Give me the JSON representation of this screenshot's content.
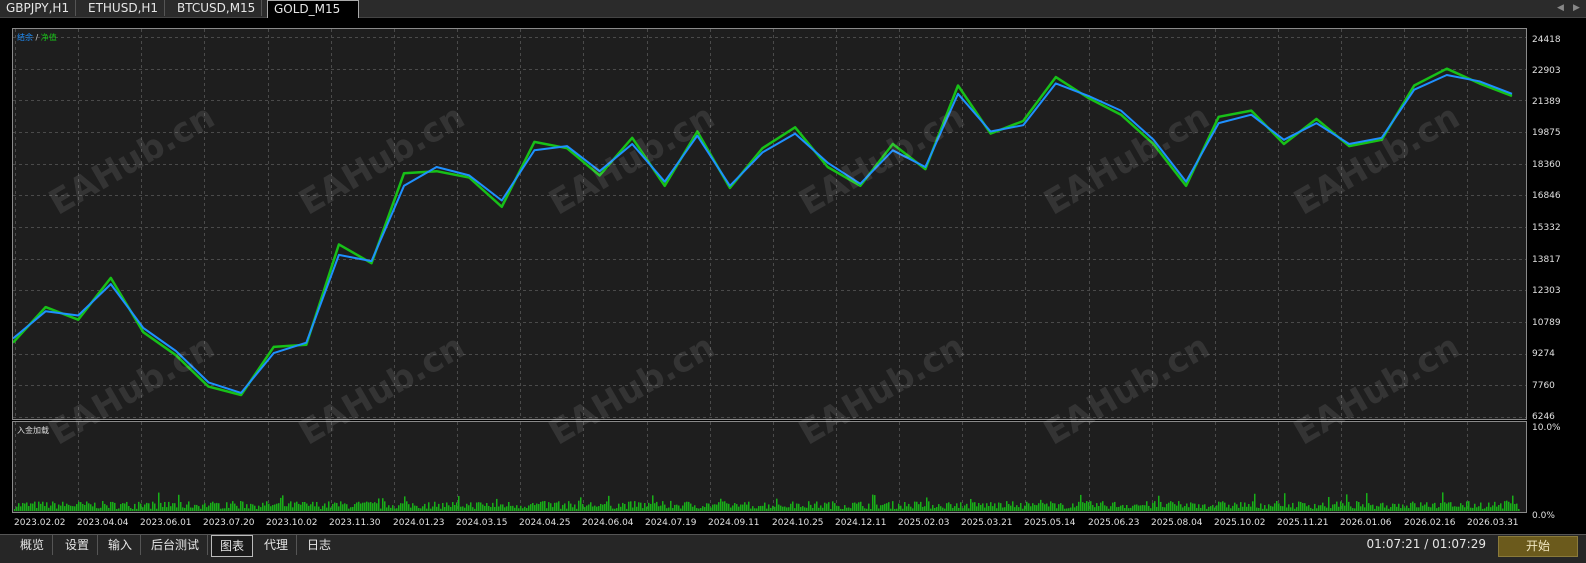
{
  "tabs": [
    "GBPJPY,H1",
    "ETHUSD,H1",
    "BTCUSD,M15",
    "GOLD_M15"
  ],
  "active_tab": "GOLD_M15",
  "legend": {
    "balance": "结余",
    "slash": "/",
    "equity": "净值"
  },
  "sub_title": "入金加载",
  "colors": {
    "balance": "#1e90ff",
    "equity": "#18c018",
    "load": "#18b018",
    "grid": "#4a4a4a"
  },
  "y_axis_main": [
    "24418",
    "22903",
    "21389",
    "19875",
    "18360",
    "16846",
    "15332",
    "13817",
    "12303",
    "10789",
    "9274",
    "7760",
    "6246"
  ],
  "y_axis_sub": [
    "10.0%",
    "0.0%"
  ],
  "x_axis": [
    "2023.02.02",
    "2023.04.04",
    "2023.06.01",
    "2023.07.20",
    "2023.10.02",
    "2023.11.30",
    "2024.01.23",
    "2024.03.15",
    "2024.04.25",
    "2024.06.04",
    "2024.07.19",
    "2024.09.11",
    "2024.10.25",
    "2024.12.11",
    "2025.02.03",
    "2025.03.21",
    "2025.05.14",
    "2025.06.23",
    "2025.08.04",
    "2025.10.02",
    "2025.11.21",
    "2026.01.06",
    "2026.02.16",
    "2026.03.31"
  ],
  "watermark": "EAHub.cn",
  "bottom_tabs": [
    "概览",
    "设置",
    "输入",
    "后台测试",
    "图表",
    "代理",
    "日志"
  ],
  "active_bottom_tab": "图表",
  "time_display": "01:07:21 / 01:07:29",
  "start_button": "开始",
  "chart_data": {
    "type": "line",
    "ylim": [
      6246,
      24418
    ],
    "series": [
      {
        "name": "结余",
        "values": [
          10000,
          11300,
          11100,
          12600,
          10500,
          9400,
          7900,
          7400,
          9300,
          9800,
          14000,
          13700,
          17300,
          18200,
          17800,
          16600,
          19000,
          19200,
          18000,
          19300,
          17500,
          19700,
          17300,
          18900,
          19800,
          18400,
          17400,
          19000,
          18200,
          21700,
          19900,
          20200,
          22200,
          21600,
          20900,
          19500,
          17500,
          20300,
          20700,
          19500,
          20300,
          19300,
          19600,
          21900,
          22600,
          22300,
          21700
        ]
      },
      {
        "name": "净值",
        "values": [
          9800,
          11500,
          10900,
          12900,
          10300,
          9200,
          7700,
          7300,
          9600,
          9700,
          14500,
          13600,
          17900,
          18000,
          17700,
          16300,
          19400,
          19100,
          17800,
          19600,
          17300,
          19900,
          17200,
          19100,
          20100,
          18200,
          17300,
          19300,
          18100,
          22100,
          19800,
          20400,
          22500,
          21500,
          20700,
          19300,
          17300,
          20600,
          20900,
          19300,
          20500,
          19200,
          19500,
          22100,
          22900,
          22200,
          21600
        ]
      }
    ]
  }
}
